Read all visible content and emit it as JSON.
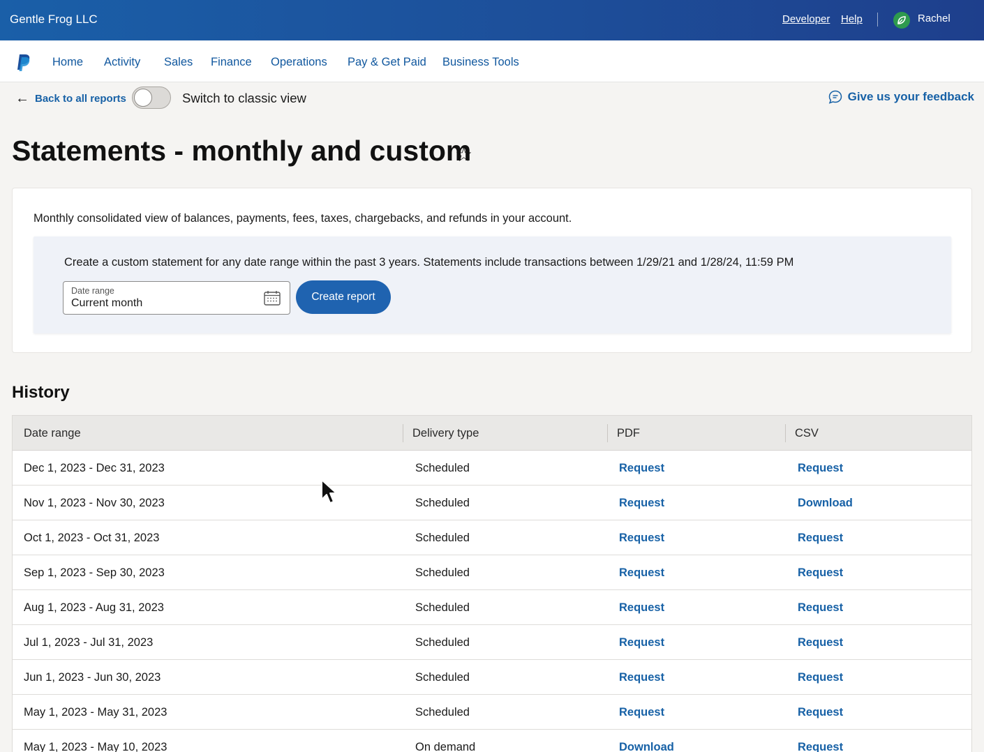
{
  "topbar": {
    "company": "Gentle Frog LLC",
    "links": [
      "Developer",
      "Help"
    ],
    "user": "Rachel"
  },
  "nav": {
    "items": [
      "Home",
      "Activity",
      "Sales",
      "Finance",
      "Operations",
      "Pay & Get Paid",
      "Business Tools"
    ]
  },
  "subbar": {
    "back_label": "Back to all reports",
    "toggle_label": "Switch to classic view",
    "toggle_on": false,
    "feedback_label": "Give us your feedback"
  },
  "page": {
    "title": "Statements - monthly and custom"
  },
  "card": {
    "description": "Monthly consolidated view of balances, payments, fees, taxes, chargebacks, and refunds in your account.",
    "custom_text": "Create a custom statement for any date range within the past 3 years. Statements include transactions between 1/29/21 and 1/28/24, 11:59 PM",
    "date_label": "Date range",
    "date_value": "Current month",
    "create_button": "Create report"
  },
  "history": {
    "title": "History",
    "columns": [
      "Date range",
      "Delivery type",
      "PDF",
      "CSV"
    ],
    "rows": [
      {
        "range": "Dec 1, 2023 - Dec 31, 2023",
        "delivery": "Scheduled",
        "pdf": "Request",
        "csv": "Request"
      },
      {
        "range": "Nov 1, 2023 - Nov 30, 2023",
        "delivery": "Scheduled",
        "pdf": "Request",
        "csv": "Download"
      },
      {
        "range": "Oct 1, 2023 - Oct 31, 2023",
        "delivery": "Scheduled",
        "pdf": "Request",
        "csv": "Request"
      },
      {
        "range": "Sep 1, 2023 - Sep 30, 2023",
        "delivery": "Scheduled",
        "pdf": "Request",
        "csv": "Request"
      },
      {
        "range": "Aug 1, 2023 - Aug 31, 2023",
        "delivery": "Scheduled",
        "pdf": "Request",
        "csv": "Request"
      },
      {
        "range": "Jul 1, 2023 - Jul 31, 2023",
        "delivery": "Scheduled",
        "pdf": "Request",
        "csv": "Request"
      },
      {
        "range": "Jun 1, 2023 - Jun 30, 2023",
        "delivery": "Scheduled",
        "pdf": "Request",
        "csv": "Request"
      },
      {
        "range": "May 1, 2023 - May 31, 2023",
        "delivery": "Scheduled",
        "pdf": "Request",
        "csv": "Request"
      },
      {
        "range": "May 1, 2023 - May 10, 2023",
        "delivery": "On demand",
        "pdf": "Download",
        "csv": "Request"
      }
    ]
  },
  "colors": {
    "topbar": "#1d4f9a",
    "link": "#1761a6",
    "button": "#1f63b0",
    "panel": "#eff2f8"
  }
}
